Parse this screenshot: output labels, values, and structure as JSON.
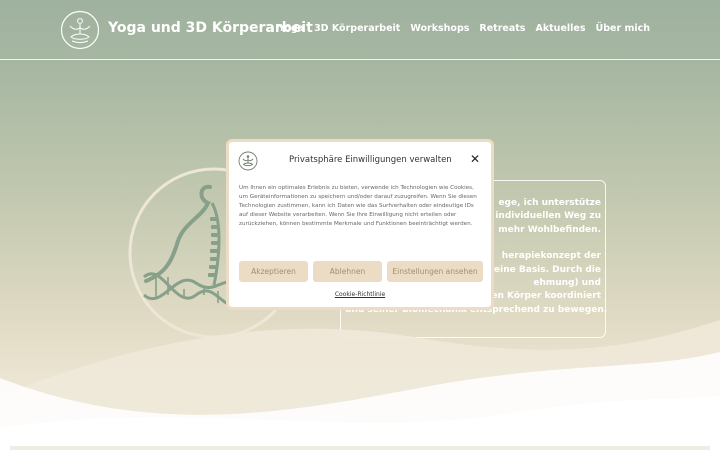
{
  "header": {
    "site_title": "Yoga und 3D Körperarbeit",
    "logo_icon": "meditation-figure-icon",
    "nav": [
      "Yoga",
      "3D Körperarbeit",
      "Workshops",
      "Retreats",
      "Aktuelles",
      "Über mich"
    ]
  },
  "hero": {
    "emblem_icon": "spine-dna-emblem-icon",
    "content_lines": [
      "ege, ich unterstütze",
      "individuellen Weg zu",
      "mehr Wohlbefinden.",
      "herapiekonzept der",
      "eine Basis. Durch die",
      "ehmung) und",
      "aren Körper koordiniert",
      "und seiner Biomechanik entsprechend zu bewegen."
    ]
  },
  "consent": {
    "title": "Privatsphäre Einwilligungen verwalten",
    "close_icon": "close-icon",
    "body": "Um Ihnen ein optimales Erlebnis zu bieten, verwende ich Technologien wie Cookies, um Geräteinformationen zu speichern und/oder darauf zuzugreifen. Wenn Sie diesen Technologien zustimmen, kann ich Daten wie das Surfverhalten oder eindeutige IDs auf dieser Website verarbeiten. Wenn Sie Ihre Einwilligung nicht erteilen oder zurückziehen, können bestimmte Merkmale und Funktionen beeinträchtigt werden.",
    "accept_label": "Akzeptieren",
    "decline_label": "Ablehnen",
    "settings_label": "Einstellungen ansehen",
    "policy_link": "Cookie-Richtlinie"
  },
  "colors": {
    "sage": "#9fb29f",
    "sand": "#ece5d3",
    "button_bg": "#ecdcc6",
    "button_text": "#a28d74",
    "emblem_green": "#7f9c86"
  }
}
